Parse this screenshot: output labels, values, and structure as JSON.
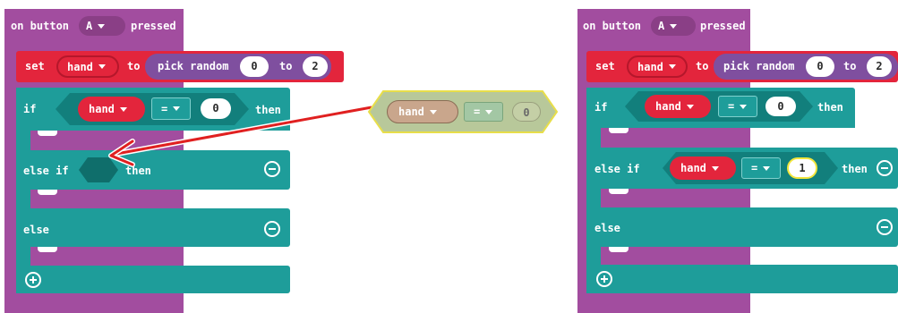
{
  "left": {
    "event": {
      "prefix": "on button",
      "button": "A",
      "suffix": "pressed"
    },
    "set": {
      "label": "set",
      "var": "hand",
      "to": "to",
      "func": "pick random",
      "from": "0",
      "to2": "to",
      "max": "2"
    },
    "if": {
      "label": "if",
      "var": "hand",
      "op": "=",
      "value": "0",
      "then": "then"
    },
    "elseif": {
      "label": "else if",
      "then": "then"
    },
    "else": {
      "label": "else"
    }
  },
  "dragged": {
    "var": "hand",
    "op": "=",
    "value": "0"
  },
  "right": {
    "event": {
      "prefix": "on button",
      "button": "A",
      "suffix": "pressed"
    },
    "set": {
      "label": "set",
      "var": "hand",
      "to": "to",
      "func": "pick random",
      "from": "0",
      "to2": "to",
      "max": "2"
    },
    "if": {
      "label": "if",
      "var": "hand",
      "op": "=",
      "value": "0",
      "then": "then"
    },
    "elseif": {
      "label": "else if",
      "var": "hand",
      "op": "=",
      "value": "1",
      "then": "then"
    },
    "else": {
      "label": "else"
    }
  },
  "colors": {
    "event": "#a24d9f",
    "variable": "#e3253c",
    "logic": "#1e9d9a",
    "math": "#7f4f9f",
    "arrow": "#e02020"
  }
}
